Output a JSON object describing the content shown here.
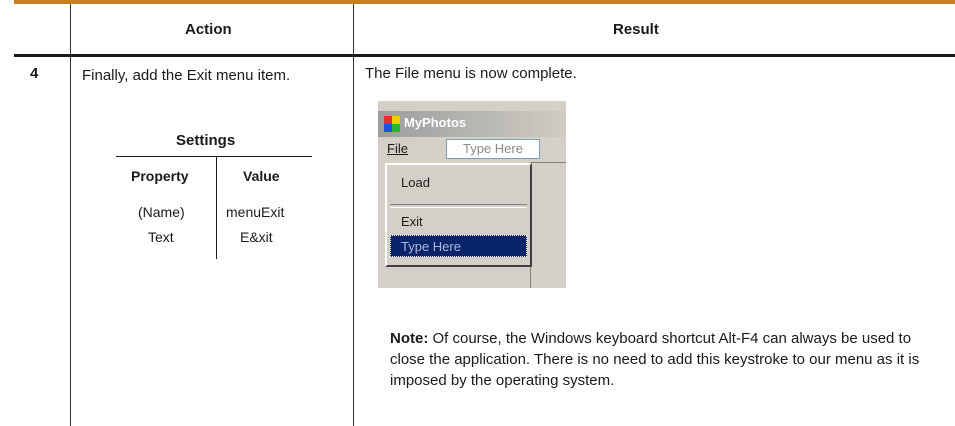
{
  "table": {
    "header_action": "Action",
    "header_result": "Result",
    "step_number": "4",
    "action_text": "Finally, add the Exit menu item.",
    "result_text": "The File menu is now complete."
  },
  "settings": {
    "title": "Settings",
    "col_property": "Property",
    "col_value": "Value",
    "rows": [
      {
        "property": "(Name)",
        "value": "menuExit"
      },
      {
        "property": "Text",
        "value": "E&xit"
      }
    ]
  },
  "screenshot": {
    "window_title": "MyPhotos",
    "menu_file": "File",
    "type_here": "Type Here",
    "items": [
      "Load",
      "Exit"
    ],
    "dropdown_type_here": "Type Here"
  },
  "note": {
    "label": "Note:",
    "text": " Of course, the Windows keyboard shortcut Alt-F4 can always be used to close the application. There is no need to add this keystroke to our menu as it is imposed by the operating system."
  }
}
